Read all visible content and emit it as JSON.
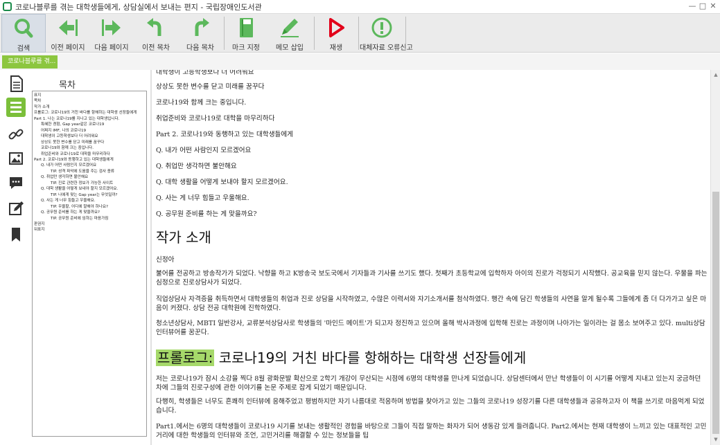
{
  "window": {
    "title": "코로나블루를 겪는 대학생들에게, 상담실에서 보내는 편지 - 국립장애인도서관"
  },
  "toolbar": {
    "buttons": [
      {
        "label": "검색",
        "icon": "search-icon"
      },
      {
        "label": "이전 페이지",
        "icon": "prev-page-icon"
      },
      {
        "label": "다음 페이지",
        "icon": "next-page-icon"
      },
      {
        "label": "이전 목차",
        "icon": "prev-toc-icon"
      },
      {
        "label": "다음 목차",
        "icon": "next-toc-icon"
      },
      {
        "label": "마크 지정",
        "icon": "bookmark-mark-icon"
      },
      {
        "label": "메모 삽입",
        "icon": "memo-pen-icon"
      },
      {
        "label": "재생",
        "icon": "play-icon"
      },
      {
        "label": "대체자료 오류신고",
        "icon": "error-report-icon"
      }
    ],
    "accent_green": "#5cb85c",
    "play_red": "#e2001a"
  },
  "tab": {
    "label": "코로나블루를 겪..."
  },
  "rail": {
    "items": [
      "document-icon",
      "toc-list-icon",
      "link-icon",
      "image-icon",
      "comment-icon",
      "edit-note-icon",
      "bookmark-icon"
    ],
    "active_color": "#7bbf3a"
  },
  "toc": {
    "header": "목차",
    "items": [
      "표지",
      "목차",
      "작가 소개",
      "프롤로그: 코로나19의 거친 바다를 항해하는 대학생 선장들에게",
      "Part 1. 나는 코로나19를 지나고 있는 대학생입니다.",
      "특혜한 경험, Gap year같은 코로나19",
      "어쩌지 IMF, 나의 코로나19",
      "대학생이 고등학생보다 더 어려워요",
      "상상도 못한 변수를 닫고 미래를 꿈꾸다",
      "코로나19와 함께 크는 중입니다.",
      "취업준비와 코로나19로 대학을 마무리하다",
      "Part 2. 코로나19와 동행하고 있는 대학생들에게",
      "Q. 내가 어떤 사람인지 모르겠어요",
      "TIP. 성격 파악에 도움을 주는 검사 종류",
      "Q. 취업만 생각하면 불안해요",
      "TIP. 진로 관련한 정보가 가능한 사이트",
      "Q. 대학 생활을 어떻게 보내야 할지 모르겠어요.",
      "TIP. 나에게 맞는 Gap year는 무엇일까?",
      "Q. 사는 게 너무 힘들고 우울해요.",
      "TIP. 우울할, 어디에 말해야 하나요?",
      "Q. 공무원 준비를 하는 게 맞을까요?",
      "TIP. 공무원 준비에 임하는 마음가짐",
      "판권지",
      "뒤표지"
    ]
  },
  "content": {
    "partial_top": "대학생이 고등학생보다 더 어려워요",
    "lines": [
      "상상도 못한 변수를 닫고 미래를 꿈꾸다",
      "코로나19와 함께 크는 중입니다.",
      "취업준비와 코로나19로 대학을 마무리하다",
      "Part 2. 코로나19와 동행하고 있는 대학생들에게",
      "Q. 내가 어떤 사람인지 모르겠어요",
      "Q. 취업만 생각하면 불안해요",
      "Q. 대학 생활을 어떻게 보내야 할지 모르겠어요.",
      "Q. 사는 게 너무 힘들고 우울해요.",
      "Q. 공무원 준비를 하는 게 맞을까요?"
    ],
    "author_heading": "작가 소개",
    "author_name": "신정아",
    "author_paras": [
      "불어를 전공하고 방송작가가 되었다. 낙향을 하고 K방송국 보도국에서 기자들과 기사를 쓰기도 했다. 첫째가 초등학교에 입학하자 아이의 진로가 걱정되기 시작했다. 공교육을 믿지 않는다. 우물을 파는 심정으로 진로상담사가 되었다.",
      "직업상담사 자격증을 취득하면서 대학생들의 취업과 진로 상담을 시작하였고, 수많은 이력서와 자기소개서를 첨삭하였다. 행간 속에 담긴 학생들의 사연을 알게 될수록 그들에게 좀 더 다가가고 싶은 마음이 커졌다. 상담 전공 대학원에 진학하였다.",
      "청소년상담사, MBTI 일반강사, 교류분석상담사로 학생들의 '마인드 메이트'가 되고자 정진하고 있으며 올해 박사과정에 입학해 진로는 과정이며 나아가는 일이라는 걸 몸소 보여주고 있다. multi상담 인터뷰어를 꿈꾼다."
    ],
    "prologue_highlight": "프롤로그:",
    "prologue_rest": " 코로나19의 거친 바다를 항해하는 대학생 선장들에게",
    "prologue_highlight_color": "#a6d96a",
    "prologue_paras": [
      "저는 코로나19가 잠시 소강을 찍다 8월 광화문발 확산으로 2학기 개강이 무산되는 시점에 6명의 대학생을 만나게 되었습니다. 상담센터에서 만난 학생들이 이 시기를 어떻게 지내고 있는지 궁금하던 차에 그들의 진로구성에 관한 이야기를 논문 주제로 잡게 되었기 때문입니다.",
      "다행히, 학생들은 너무도 흔쾌히 인터뷰에 응해주었고 평범하지만 자기 나름대로 적응하며 방법을 찾아가고 있는 그들의 코로나19 성장기를 다른 대학생들과 공유하고자 이 책을 쓰기로 마음먹게 되었습니다.",
      "Part1.에서는 6명의 대학생들이 코로나19 시기를 보내는 생활적인 경험을 바탕으로 그들이 직접 말하는 화자가 되어 생동감 있게 들려줍니다. Part2.에서는 현재 대학생이 느끼고 있는 대표적인 고민거리에 대한 학생들의 인터뷰와 조언, 고민거리를 해결할 수 있는 정보들을 팁"
    ]
  }
}
